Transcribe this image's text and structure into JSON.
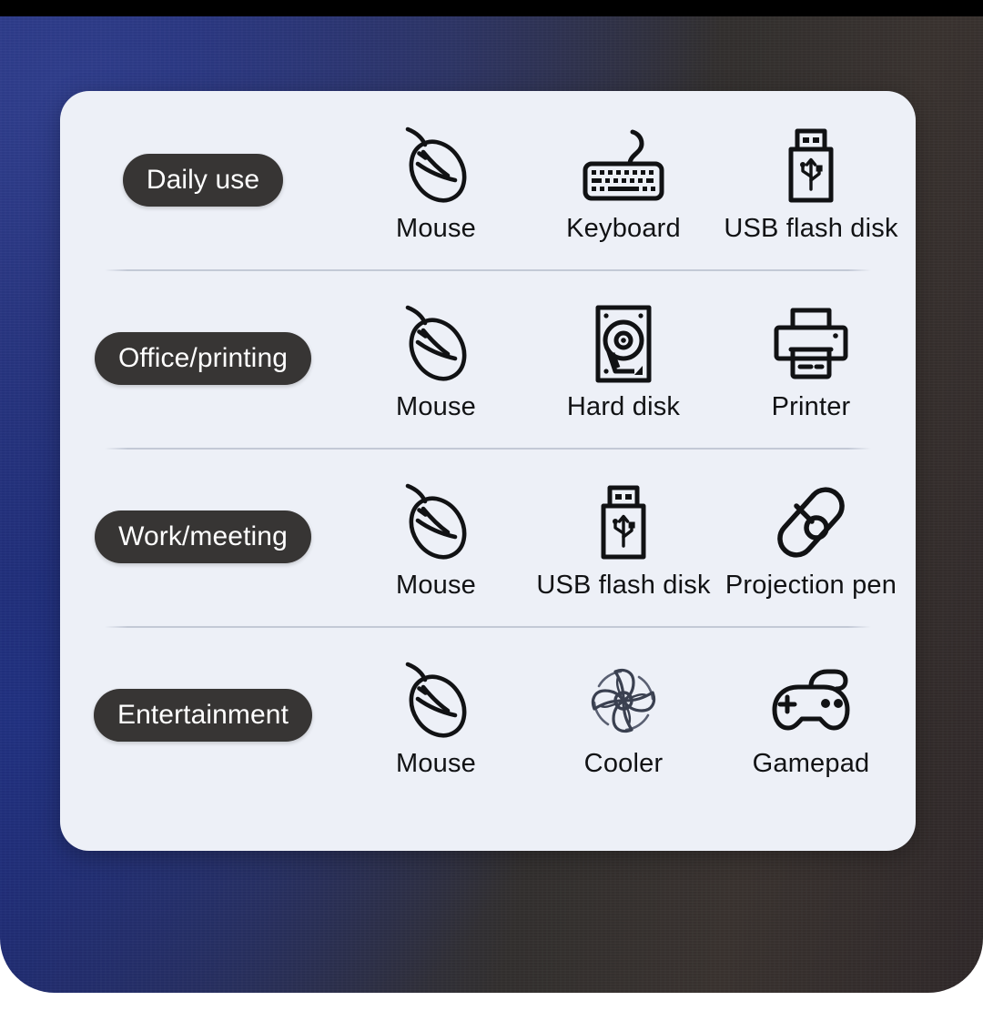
{
  "page": {
    "background_top_bar_color": "#000000",
    "backdrop_gradient_from": "#23307a",
    "backdrop_gradient_to": "#30292a",
    "card_background_color": "#edf0f7",
    "pill_background_color": "#373534",
    "pill_text_color": "#ffffff",
    "label_text_color": "#111214",
    "divider_color": "#c3c9d6"
  },
  "rows": [
    {
      "category": "Daily use",
      "items": [
        {
          "label": "Mouse",
          "icon": "mouse-icon"
        },
        {
          "label": "Keyboard",
          "icon": "keyboard-icon"
        },
        {
          "label": "USB flash disk",
          "icon": "usb-flash-disk-icon"
        }
      ]
    },
    {
      "category": "Office/printing",
      "items": [
        {
          "label": "Mouse",
          "icon": "mouse-icon"
        },
        {
          "label": "Hard disk",
          "icon": "hard-disk-icon"
        },
        {
          "label": "Printer",
          "icon": "printer-icon"
        }
      ]
    },
    {
      "category": "Work/meeting",
      "items": [
        {
          "label": "Mouse",
          "icon": "mouse-icon"
        },
        {
          "label": "USB flash disk",
          "icon": "usb-flash-disk-icon"
        },
        {
          "label": "Projection pen",
          "icon": "projection-pen-icon"
        }
      ]
    },
    {
      "category": "Entertainment",
      "items": [
        {
          "label": "Mouse",
          "icon": "mouse-icon"
        },
        {
          "label": "Cooler",
          "icon": "cooler-fan-icon"
        },
        {
          "label": "Gamepad",
          "icon": "gamepad-icon"
        }
      ]
    }
  ]
}
